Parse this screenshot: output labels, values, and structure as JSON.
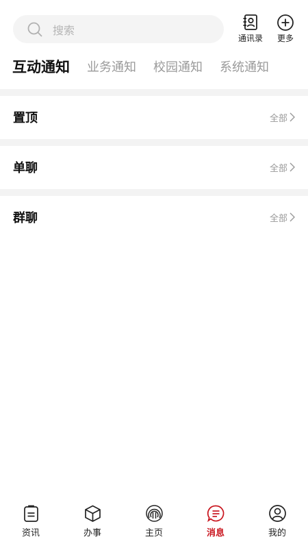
{
  "search": {
    "placeholder": "搜索"
  },
  "header_actions": [
    {
      "label": "通讯录",
      "icon": "contacts-icon"
    },
    {
      "label": "更多",
      "icon": "plus-circle-icon"
    }
  ],
  "tabs": [
    {
      "label": "互动通知",
      "active": true
    },
    {
      "label": "业务通知",
      "active": false
    },
    {
      "label": "校园通知",
      "active": false
    },
    {
      "label": "系统通知",
      "active": false
    }
  ],
  "sections": [
    {
      "title": "置顶",
      "more": "全部"
    },
    {
      "title": "单聊",
      "more": "全部"
    },
    {
      "title": "群聊",
      "more": "全部"
    }
  ],
  "bottom_nav": [
    {
      "label": "资讯",
      "icon": "news-icon",
      "active": false
    },
    {
      "label": "办事",
      "icon": "cube-icon",
      "active": false
    },
    {
      "label": "主页",
      "icon": "home-rings-icon",
      "active": false
    },
    {
      "label": "消息",
      "icon": "message-icon",
      "active": true
    },
    {
      "label": "我的",
      "icon": "user-icon",
      "active": false
    }
  ],
  "colors": {
    "accent": "#c9151e",
    "divider": "#f3f3f3",
    "search_bg": "#f4f4f4"
  }
}
